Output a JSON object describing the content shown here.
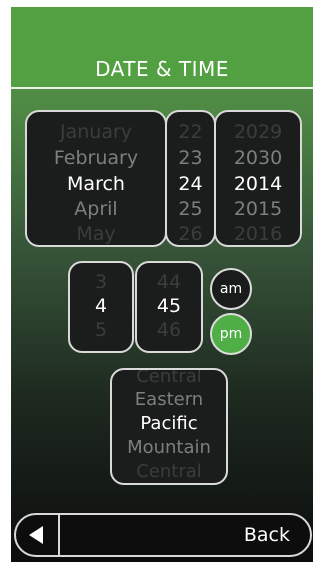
{
  "header": {
    "title": "DATE & TIME"
  },
  "date": {
    "month": {
      "items": [
        "January",
        "February",
        "March",
        "April",
        "May"
      ],
      "selected": "March"
    },
    "day": {
      "items": [
        "22",
        "23",
        "24",
        "25",
        "26"
      ],
      "selected": "24"
    },
    "year": {
      "items": [
        "2029",
        "2030",
        "2014",
        "2015",
        "2016"
      ],
      "selected": "2014"
    }
  },
  "time": {
    "hour": {
      "items": [
        "3",
        "4",
        "5"
      ],
      "selected": "4"
    },
    "minute": {
      "items": [
        "44",
        "45",
        "46"
      ],
      "selected": "45"
    },
    "am_label": "am",
    "pm_label": "pm",
    "selected_period": "pm"
  },
  "timezone": {
    "items": [
      "Central",
      "Eastern",
      "Pacific",
      "Mountain",
      "Central"
    ],
    "selected": "Pacific"
  },
  "footer": {
    "back_label": "Back"
  },
  "colors": {
    "accent": "#53a043",
    "selected_toggle": "#4fae45"
  }
}
